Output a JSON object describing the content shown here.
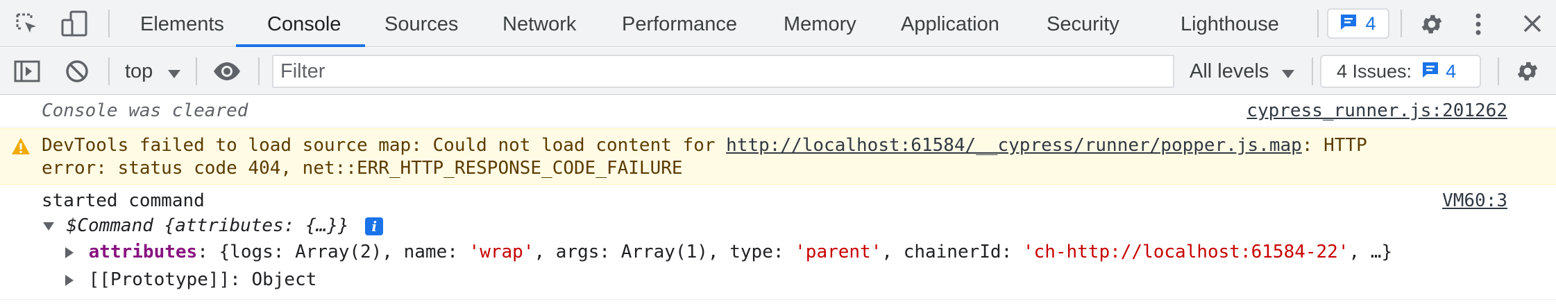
{
  "tabs": {
    "items": [
      "Elements",
      "Console",
      "Sources",
      "Network",
      "Performance",
      "Memory",
      "Application",
      "Security",
      "Lighthouse"
    ],
    "active": "Console",
    "issues_badge_count": "4"
  },
  "toolbar": {
    "context": "top",
    "filter_placeholder": "Filter",
    "levels": "All levels",
    "issues_label": "4 Issues:",
    "issues_count": "4"
  },
  "console": {
    "cleared": {
      "text": "Console was cleared",
      "source": "cypress_runner.js:201262"
    },
    "warning": {
      "prefix": "DevTools failed to load source map: Could not load content for ",
      "url": "http://localhost:61584/__cypress/runner/popper.js.map",
      "suffix": ": HTTP",
      "line2": "error: status code 404, net::ERR_HTTP_RESPONSE_CODE_FAILURE"
    },
    "log": {
      "message": "started command",
      "source": "VM60:3",
      "object_label": "$Command {attributes: {…}}",
      "attributes_key": "attributes",
      "attributes_preview": {
        "open": ": {logs: Array(2), name: ",
        "name_val": "'wrap'",
        "mid1": ", args: Array(1), type: ",
        "type_val": "'parent'",
        "mid2": ", chainerId: ",
        "chainer_val": "'ch-http://localhost:61584-22'",
        "close": ", …}"
      },
      "prototype": "[[Prototype]]: Object"
    }
  },
  "colors": {
    "accent": "#1a73e8",
    "warning_bg": "#fffbe5",
    "warning_icon": "#f2ab00",
    "key": "#881280",
    "string": "#c80000"
  }
}
